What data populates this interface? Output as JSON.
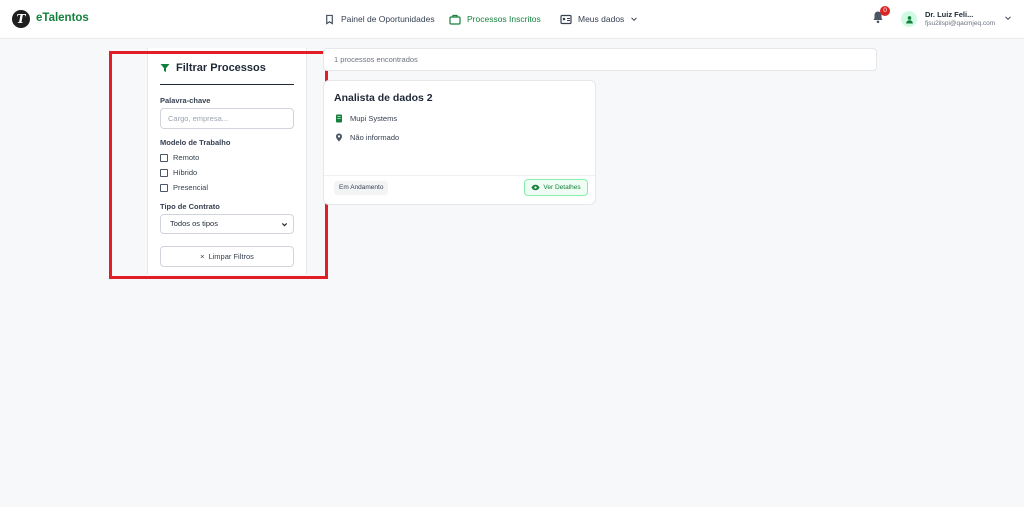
{
  "header": {
    "brand": "eTalentos",
    "logo_letter": "T",
    "nav": [
      {
        "label": "Painel de Oportunidades",
        "icon": "bookmark-icon",
        "active": false
      },
      {
        "label": "Processos Inscritos",
        "icon": "briefcase-icon",
        "active": true
      },
      {
        "label": "Meus dados",
        "icon": "id-card-icon",
        "active": false
      }
    ],
    "notification_count": "0",
    "user": {
      "name": "Dr. Luiz Feli...",
      "email": "fjsu2ilspi@qacmjeq.com"
    }
  },
  "filters": {
    "title": "Filtrar Processos",
    "keyword_label": "Palavra-chave",
    "keyword_placeholder": "Cargo, empresa...",
    "keyword_value": "",
    "work_model_label": "Modelo de Trabalho",
    "work_models": [
      {
        "label": "Remoto",
        "checked": false
      },
      {
        "label": "Híbrido",
        "checked": false
      },
      {
        "label": "Presencial",
        "checked": false
      }
    ],
    "contract_label": "Tipo de Contrato",
    "contract_selected": "Todos os tipos",
    "clear_label": "Limpar Filtros",
    "clear_icon": "×"
  },
  "results": {
    "count_text": "1 processos encontrados",
    "cards": [
      {
        "title": "Analista de dados 2",
        "company": "Mupi Systems",
        "location": "Não informado",
        "status": "Em Andamento",
        "details_label": "Ver Detalhes"
      }
    ]
  },
  "colors": {
    "accent": "#15803d",
    "highlight": "#e11d26",
    "badge": "#dc2626"
  }
}
